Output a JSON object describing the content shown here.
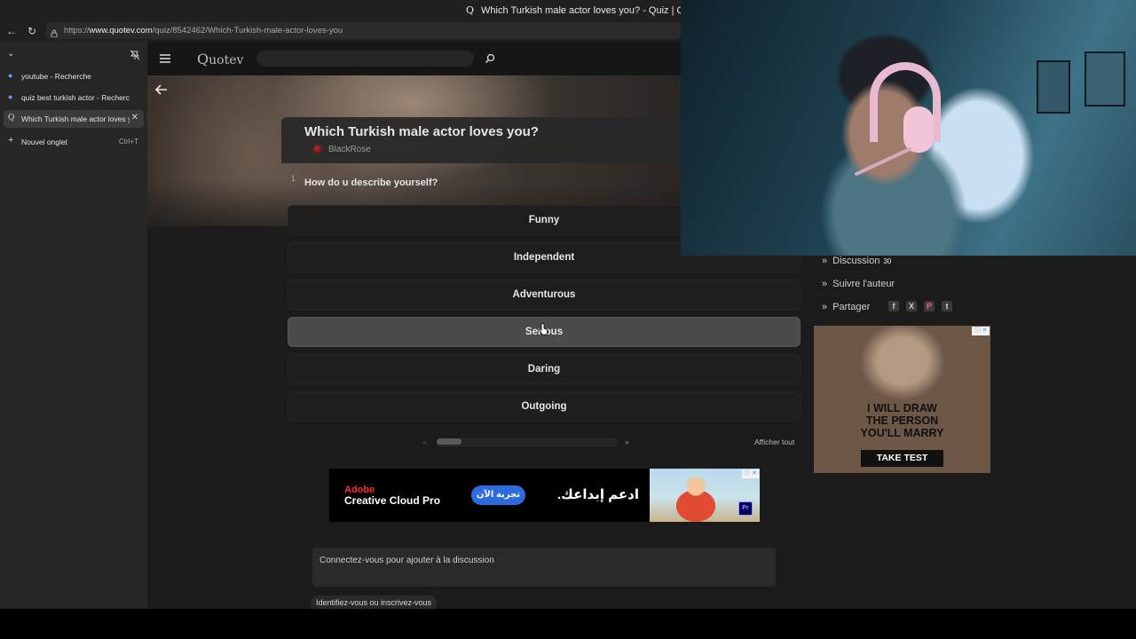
{
  "browser": {
    "window_title": "Which Turkish male actor loves you? - Quiz | Quotev",
    "title_glyph": "Q",
    "url_prefix": "https://",
    "url_domain": "www.quotev.com",
    "url_path": "/quiz/8542462/Which-Turkish-male-actor-loves-you",
    "icons": {
      "back": "back-arrow-icon",
      "reload": "reload-icon",
      "lock": "lock-icon"
    }
  },
  "tabs_panel": {
    "tabs": [
      {
        "label": "youtube - Recherche",
        "icon": "search-icon"
      },
      {
        "label": "quiz best turkish actor - Recherche",
        "icon": "search-icon"
      },
      {
        "label": "Which Turkish male actor loves you? - Quiz | Quotev",
        "icon": "quotev-icon",
        "active": true
      }
    ],
    "new_tab_label": "Nouvel onglet",
    "new_tab_shortcut": "Ctrl+T"
  },
  "site": {
    "logo_first": "Q",
    "logo_rest": "uotev",
    "search_placeholder": ""
  },
  "quiz": {
    "title": "Which Turkish male actor loves you?",
    "author": "BlackRose",
    "question_number": "1",
    "question_total": "7",
    "question": "How do u describe yourself?",
    "answers": [
      "Funny",
      "Independent",
      "Adventurous",
      "Serious",
      "Daring",
      "Outgoing"
    ],
    "hovered_answer_index": 3,
    "prev_arrow": "«",
    "next_arrow": "»",
    "show_all": "Afficher tout"
  },
  "adobe_ad": {
    "brand": "Adobe",
    "product": "Creative Cloud Pro",
    "cta": "تجربة الآن",
    "tagline": "ادعم إبداعك.",
    "badge": "Pr",
    "info": "ⓘ ✕"
  },
  "discussion": {
    "placeholder": "Connectez-vous pour ajouter à la discussion",
    "login_link": "Identifiez-vous ou inscrivez-vous"
  },
  "sidebar": {
    "discussion_label": "Discussion",
    "discussion_count": "30",
    "follow_label": "Suivre l'auteur",
    "share_label": "Partager",
    "share_icons": [
      "f",
      "X",
      "P",
      "t"
    ]
  },
  "side_ad": {
    "line1": "I WILL DRAW",
    "line2": "THE PERSON",
    "line3": "YOU'LL MARRY",
    "cta": "TAKE TEST",
    "info": "ⓘ ✕"
  }
}
